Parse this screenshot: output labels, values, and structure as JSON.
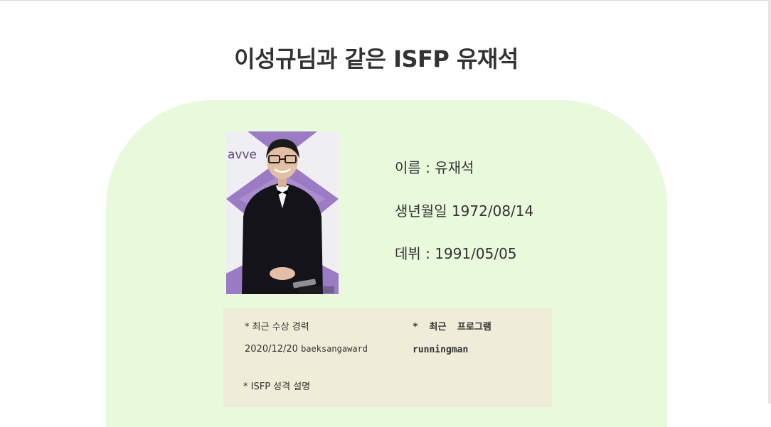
{
  "page": {
    "title": "이성규님과 같은 ISFP 유재석"
  },
  "profile": {
    "name_line": "이름 : 유재석",
    "birth_line": "생년월일 1972/08/14",
    "debut_line": "데뷔 : 1991/05/05",
    "photo_text": "avve"
  },
  "details": {
    "award_heading": "* 최근 수상 경력",
    "award_date": "2020/12/20",
    "award_name": "baeksangaward",
    "program_heading": "*  최근  프로그램",
    "program_name": "runningman",
    "personality_heading": "* ISFP 성격 설명"
  },
  "colors": {
    "card_bg": "#e9f9dc",
    "panel_bg": "#efecd8",
    "text": "#333333"
  }
}
